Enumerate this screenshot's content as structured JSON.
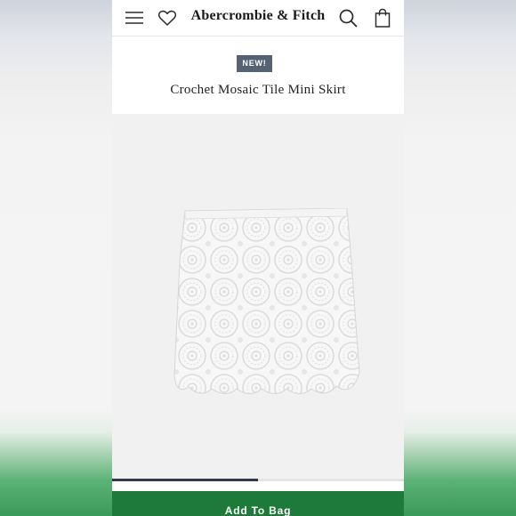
{
  "app": {
    "brand": "Abercrombie & Fitch",
    "icons": {
      "menu": "menu-icon",
      "wishlist": "heart-icon",
      "search": "search-icon",
      "bag": "shopping-bag-icon"
    }
  },
  "product": {
    "badge": "NEW!",
    "title": "Crochet Mosaic Tile Mini Skirt",
    "image": "product-image-white-crochet-skirt"
  },
  "gallery": {
    "progress": 0.5
  },
  "actions": {
    "add_to_bag": "Add To Bag"
  },
  "colors": {
    "badge": "#546271",
    "add_button": "#1e7a3a",
    "progress": "#2f3a44"
  }
}
